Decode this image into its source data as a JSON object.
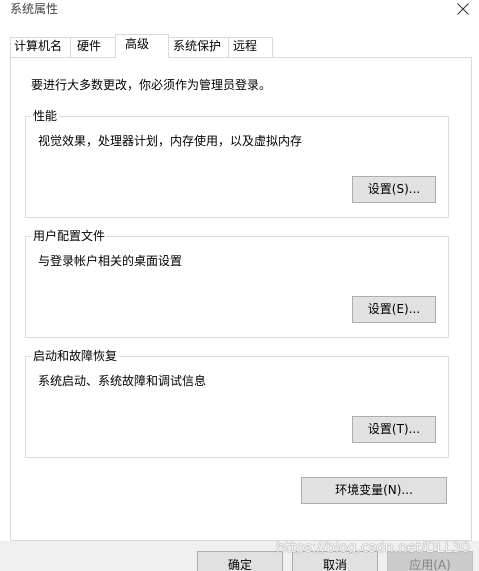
{
  "window": {
    "title": "系统属性",
    "close_icon": "close-icon"
  },
  "tabs": [
    {
      "label": "计算机名",
      "selected": false
    },
    {
      "label": "硬件",
      "selected": false
    },
    {
      "label": "高级",
      "selected": true
    },
    {
      "label": "系统保护",
      "selected": false
    },
    {
      "label": "远程",
      "selected": false
    }
  ],
  "advanced": {
    "admin_notice": "要进行大多数更改，你必须作为管理员登录。",
    "groups": [
      {
        "title": "性能",
        "description": "视觉效果，处理器计划，内存使用，以及虚拟内存",
        "button_label": "设置(S)..."
      },
      {
        "title": "用户配置文件",
        "description": "与登录帐户相关的桌面设置",
        "button_label": "设置(E)..."
      },
      {
        "title": "启动和故障恢复",
        "description": "系统启动、系统故障和调试信息",
        "button_label": "设置(T)..."
      }
    ],
    "environment_variables_label": "环境变量(N)..."
  },
  "footer": {
    "ok_label": "确定",
    "cancel_label": "取消",
    "apply_label": "应用(A)",
    "apply_enabled": false
  },
  "watermark": "https://blog.csdn.net/DLL30",
  "colors": {
    "button_face": "#e1e1e1",
    "button_border": "#adadad",
    "disabled_button_face": "#cccccc",
    "disabled_text": "#838383",
    "dialog_background": "#f0f0f0"
  }
}
